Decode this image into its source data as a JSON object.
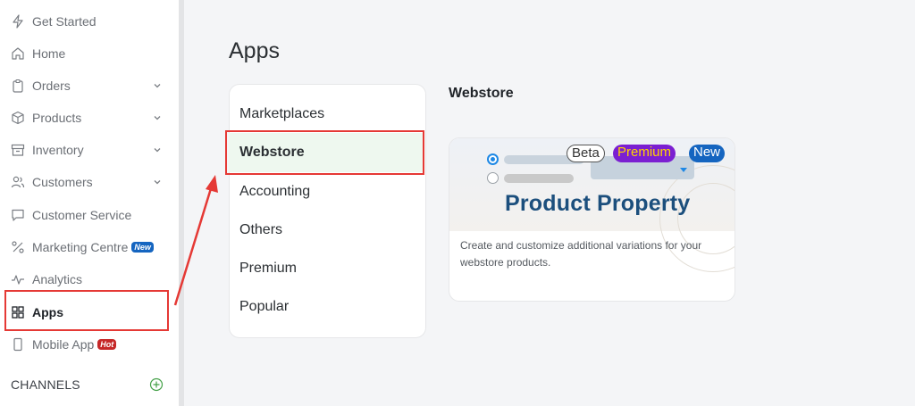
{
  "sidebar": {
    "items": [
      {
        "label": "Get Started"
      },
      {
        "label": "Home"
      },
      {
        "label": "Orders"
      },
      {
        "label": "Products"
      },
      {
        "label": "Inventory"
      },
      {
        "label": "Customers"
      },
      {
        "label": "Customer Service"
      },
      {
        "label": "Marketing Centre",
        "badge": "New"
      },
      {
        "label": "Analytics"
      },
      {
        "label": "Apps"
      },
      {
        "label": "Mobile App",
        "badge": "Hot"
      }
    ],
    "channels_label": "CHANNELS",
    "active_item": "Apps"
  },
  "main": {
    "title": "Apps",
    "categories": [
      {
        "label": "Marketplaces"
      },
      {
        "label": "Webstore"
      },
      {
        "label": "Accounting"
      },
      {
        "label": "Others"
      },
      {
        "label": "Premium"
      },
      {
        "label": "Popular"
      }
    ],
    "active_category": "Webstore",
    "section_title": "Webstore",
    "card": {
      "tags": {
        "beta": "Beta",
        "premium": "Premium",
        "new": "New"
      },
      "banner_title": "Product Property",
      "description": "Create and customize additional variations for your webstore products."
    }
  },
  "colors": {
    "highlight": "#e53935",
    "active_bg": "#eef8ef",
    "banner_title": "#1c4f7d",
    "premium_bg": "#7b1fd1",
    "premium_text": "#ffd400",
    "new_badge": "#1565c0",
    "hot_badge": "#c62828"
  }
}
